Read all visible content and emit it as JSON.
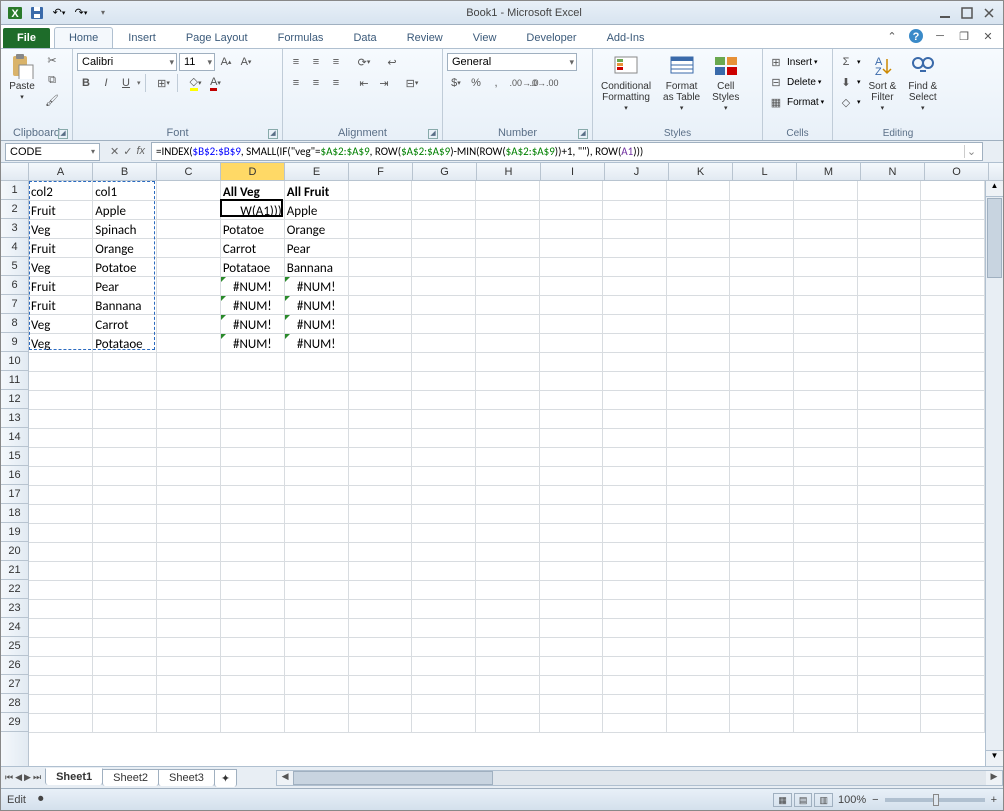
{
  "app": {
    "title": "Book1 - Microsoft Excel"
  },
  "qat": {
    "save": "Save",
    "undo": "Undo",
    "redo": "Redo"
  },
  "tabs": [
    "File",
    "Home",
    "Insert",
    "Page Layout",
    "Formulas",
    "Data",
    "Review",
    "View",
    "Developer",
    "Add-Ins"
  ],
  "activeTab": "Home",
  "ribbon": {
    "clipboard": {
      "title": "Clipboard",
      "paste": "Paste"
    },
    "font": {
      "title": "Font",
      "name": "Calibri",
      "size": "11",
      "bold": "B",
      "italic": "I",
      "underline": "U"
    },
    "alignment": {
      "title": "Alignment"
    },
    "number": {
      "title": "Number",
      "format": "General"
    },
    "styles": {
      "title": "Styles",
      "conditional": "Conditional\nFormatting",
      "table": "Format\nas Table",
      "cell": "Cell\nStyles"
    },
    "cells": {
      "title": "Cells",
      "insert": "Insert",
      "delete": "Delete",
      "format": "Format"
    },
    "editing": {
      "title": "Editing",
      "sort": "Sort &\nFilter",
      "find": "Find &\nSelect"
    }
  },
  "namebox": "CODE",
  "formula": {
    "plain": "=INDEX($B$2:$B$9, SMALL(IF(\"veg\"=$A$2:$A$9, ROW($A$2:$A$9)-MIN(ROW($A$2:$A$9))+1, \"\"), ROW(A1)))",
    "parts": [
      {
        "t": "=INDEX(",
        "c": ""
      },
      {
        "t": "$B$2:$B$9",
        "c": "fc-blue"
      },
      {
        "t": ", SMALL(IF(\"veg\"=",
        "c": ""
      },
      {
        "t": "$A$2:$A$9",
        "c": "fc-green"
      },
      {
        "t": ", ROW(",
        "c": ""
      },
      {
        "t": "$A$2:$A$9",
        "c": "fc-green"
      },
      {
        "t": ")-MIN(ROW(",
        "c": ""
      },
      {
        "t": "$A$2:$A$9",
        "c": "fc-green"
      },
      {
        "t": "))",
        "c": ""
      },
      {
        "t": "+1, \"\"), ROW(",
        "c": ""
      },
      {
        "t": "A1",
        "c": "fc-purple"
      },
      {
        "t": ")))",
        "c": ""
      }
    ]
  },
  "columns": [
    "A",
    "B",
    "C",
    "D",
    "E",
    "F",
    "G",
    "H",
    "I",
    "J",
    "K",
    "L",
    "M",
    "N",
    "O"
  ],
  "selectedCol": "D",
  "rows": 29,
  "activeCell": {
    "col": "D",
    "row": 2,
    "display": "W(A1)))"
  },
  "marchingRange": {
    "col1": "A",
    "row1": 1,
    "col2": "B",
    "row2": 9
  },
  "data": {
    "A1": "col2",
    "B1": "col1",
    "D1": "All Veg",
    "E1": "All Fruit",
    "A2": "Fruit",
    "B2": "Apple",
    "E2": "Apple",
    "A3": "Veg",
    "B3": "Spinach",
    "D3": "Potatoe",
    "E3": "Orange",
    "A4": "Fruit",
    "B4": "Orange",
    "D4": "Carrot",
    "E4": "Pear",
    "A5": "Veg",
    "B5": "Potatoe",
    "D5": "Potataoe",
    "E5": "Bannana",
    "A6": "Fruit",
    "B6": "Pear",
    "D6": "#NUM!",
    "E6": "#NUM!",
    "A7": "Fruit",
    "B7": "Bannana",
    "D7": "#NUM!",
    "E7": "#NUM!",
    "A8": "Veg",
    "B8": "Carrot",
    "D8": "#NUM!",
    "E8": "#NUM!",
    "A9": "Veg",
    "B9": "Potataoe",
    "D9": "#NUM!",
    "E9": "#NUM!"
  },
  "boldCells": [
    "D1",
    "E1"
  ],
  "errorCells": [
    "D6",
    "E6",
    "D7",
    "E7",
    "D8",
    "E8",
    "D9",
    "E9"
  ],
  "sheets": [
    "Sheet1",
    "Sheet2",
    "Sheet3"
  ],
  "activeSheet": "Sheet1",
  "status": {
    "mode": "Edit",
    "zoom": "100%"
  }
}
